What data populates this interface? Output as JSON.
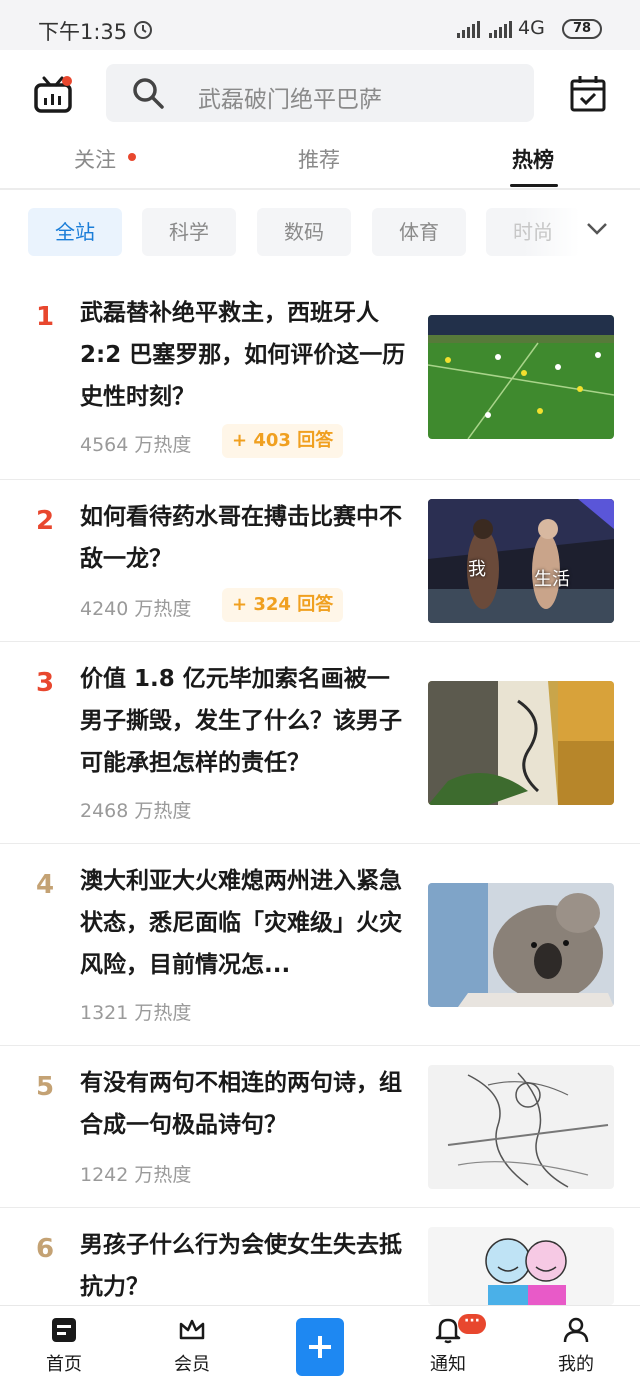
{
  "status_bar": {
    "time": "下午1:35",
    "network": "4G",
    "battery": "78"
  },
  "header": {
    "search_placeholder": "武磊破门绝平巴萨",
    "tabs": [
      {
        "label": "关注"
      },
      {
        "label": "推荐"
      },
      {
        "label": "热榜"
      }
    ],
    "active_tab": "热榜"
  },
  "categories": [
    {
      "label": "全站",
      "active": true
    },
    {
      "label": "科学"
    },
    {
      "label": "数码"
    },
    {
      "label": "体育"
    },
    {
      "label": "时尚"
    }
  ],
  "hot_list": [
    {
      "rank": "1",
      "title": "武磊替补绝平救主，西班牙人 2:2 巴塞罗那，如何评价这一历史性时刻？",
      "heat": "4564 万热度",
      "answers": "+ 403 回答"
    },
    {
      "rank": "2",
      "title": "如何看待药水哥在搏击比赛中不敌一龙？",
      "heat": "4240 万热度",
      "answers": "+ 324 回答",
      "thumb_captions": [
        "我",
        "生活"
      ]
    },
    {
      "rank": "3",
      "title": "价值 1.8 亿元毕加索名画被一男子撕毁，发生了什么？该男子可能承担怎样的责任？",
      "heat": "2468 万热度"
    },
    {
      "rank": "4",
      "title": "澳大利亚大火难熄两州进入紧急状态，悉尼面临「灾难级」火灾风险，目前情况怎...",
      "heat": "1321 万热度"
    },
    {
      "rank": "5",
      "title": "有没有两句不相连的两句诗，组合成一句极品诗句？",
      "heat": "1242 万热度"
    },
    {
      "rank": "6",
      "title": "男孩子什么行为会使女生失去抵抗力？",
      "heat": ""
    }
  ],
  "bottom_nav": [
    {
      "label": "首页",
      "icon": "home-icon"
    },
    {
      "label": "会员",
      "icon": "crown-icon"
    },
    {
      "label": "",
      "icon": "plus-icon"
    },
    {
      "label": "通知",
      "icon": "bell-icon",
      "badge": "···"
    },
    {
      "label": "我的",
      "icon": "user-icon"
    }
  ],
  "colors": {
    "accent_blue": "#1e88f2",
    "rank_red": "#e8472e",
    "rank_gold": "#c4a274",
    "answers_orange": "#f0a020"
  }
}
